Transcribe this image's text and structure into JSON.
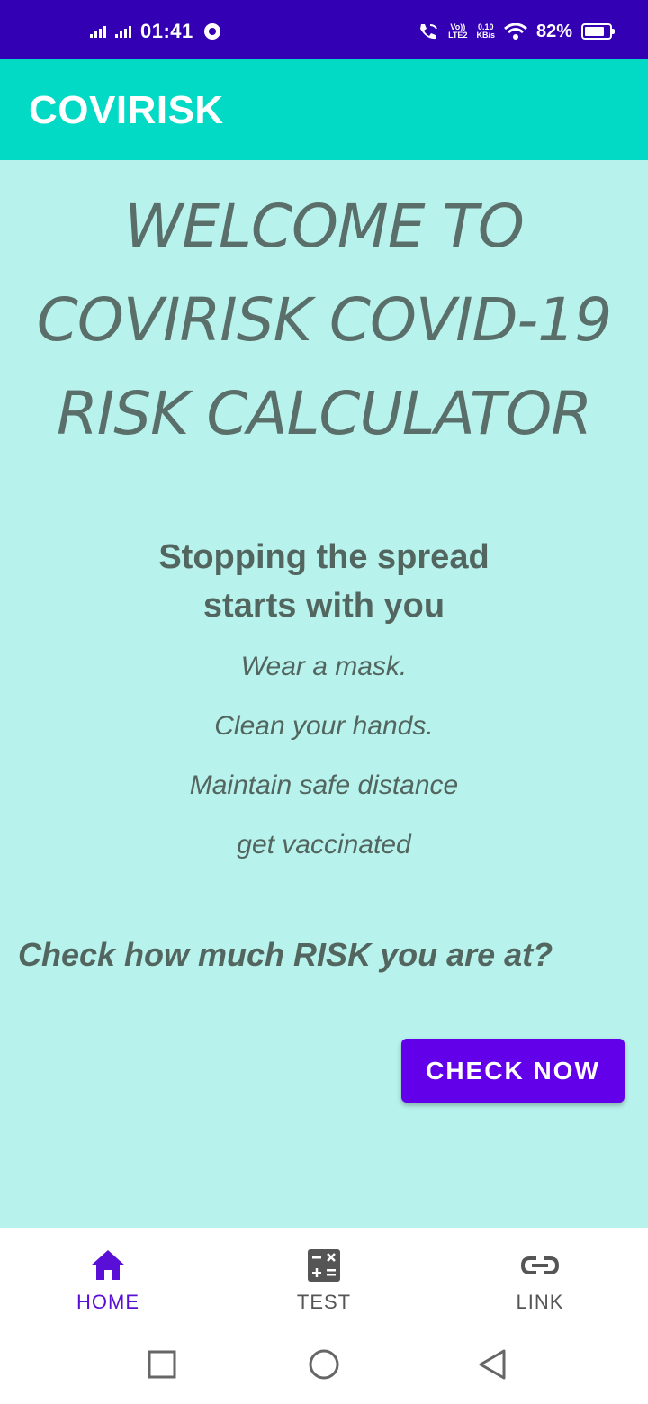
{
  "status": {
    "time": "01:41",
    "volte_top": "Vo))",
    "volte_bottom": "LTE2",
    "speed_value": "0.10",
    "speed_unit": "KB/s",
    "battery": "82%",
    "battery_level": 0.82
  },
  "app": {
    "title": "COVIRISK"
  },
  "welcome": {
    "line1": "WELCOME TO",
    "line2": "COVIRISK COVID-19",
    "line3": "RISK CALCULATOR"
  },
  "slogan": {
    "line1": "Stopping the spread",
    "line2": "starts with you"
  },
  "tips": [
    "Wear a mask.",
    "Clean your hands.",
    "Maintain safe distance",
    "get vaccinated"
  ],
  "question": "Check how much RISK you are at?",
  "cta": {
    "label": "CHECK NOW"
  },
  "nav": {
    "items": [
      {
        "label": "HOME",
        "icon": "home-icon",
        "active": true
      },
      {
        "label": "TEST",
        "icon": "calculator-icon",
        "active": false
      },
      {
        "label": "LINK",
        "icon": "link-icon",
        "active": false
      }
    ]
  },
  "colors": {
    "status_bar": "#3300b4",
    "app_bar": "#03dac5",
    "background": "#b8f2ec",
    "accent": "#6200ea",
    "text": "#52665f"
  }
}
